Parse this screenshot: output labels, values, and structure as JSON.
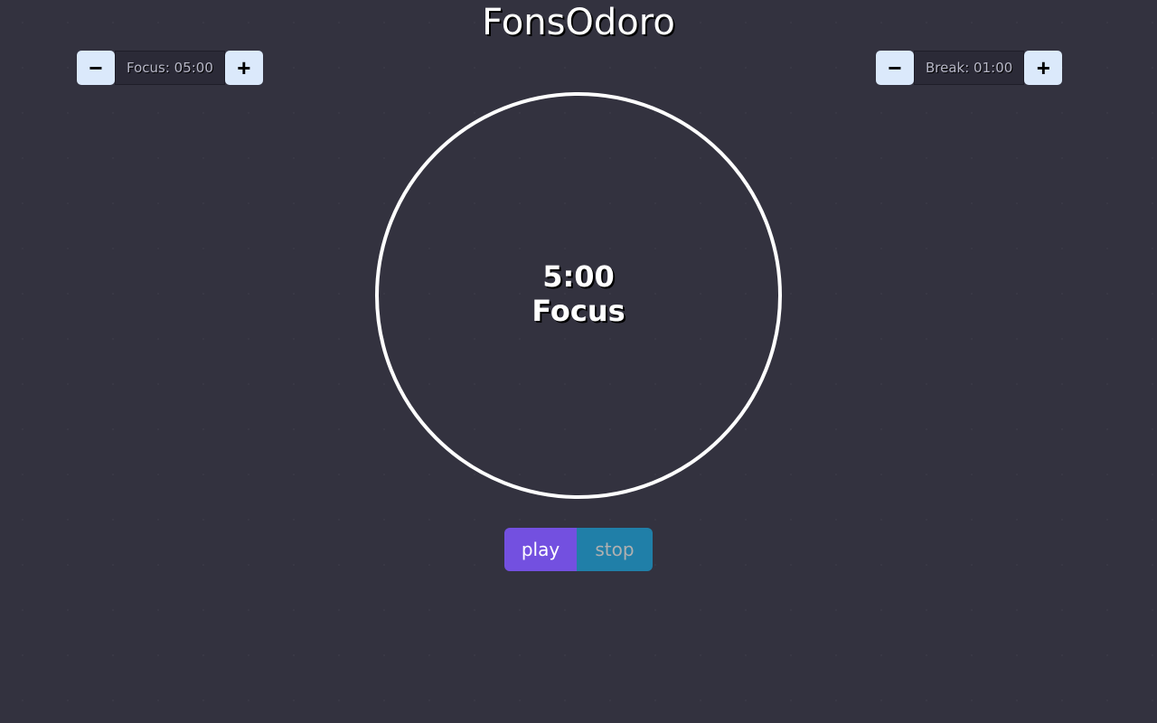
{
  "title": "FonsOdoro",
  "focus": {
    "label": "Focus: 05:00",
    "minus": "−",
    "plus": "+"
  },
  "break": {
    "label": "Break: 01:00",
    "minus": "−",
    "plus": "+"
  },
  "timer": {
    "time": "5:00",
    "mode": "Focus"
  },
  "controls": {
    "play": "play",
    "stop": "stop"
  }
}
